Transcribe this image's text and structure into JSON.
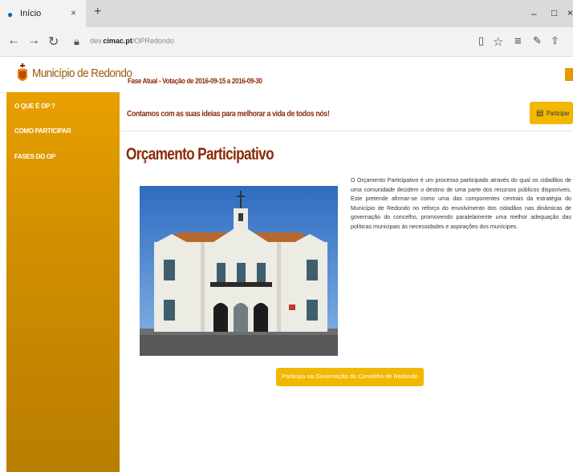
{
  "browser": {
    "tab_title": "Início",
    "tab_close": "×",
    "new_tab": "+",
    "url_prefix": "dev.",
    "url_domain": "cimac.pt",
    "url_path": "/OPRedondo",
    "minimize": "–",
    "maximize": "□",
    "close": "×"
  },
  "header": {
    "logo_text": "Município de Redondo",
    "phase_text": "Fase Atual - Votação de 2016-09-15 a 2016-09-30"
  },
  "sidebar": {
    "items": [
      {
        "label": "O QUE É OP ?"
      },
      {
        "label": "COMO PARTICIPAR"
      },
      {
        "label": "FASES DO OP"
      }
    ]
  },
  "tagline": "Contamos com as suas ideias para melhorar a vida de todos nós!",
  "participar_label": "Participar",
  "page_title": "Orçamento Participativo",
  "description": "O Orçamento Participativo é um processo participado através do qual os cidadãos de uma comunidade decidem o destino de uma parte dos recursos públicos disponíveis. Este pretende afirmar-se como uma das componentes centrais da estratégia do Município de Redondo no reforço do envolvimento dos cidadãos nas dinâmicas de governação do concelho, promovendo paralelamente uma melhor adequação das políticas municipais às necessidades e aspirações dos munícipes.",
  "cta_label": "Participa na Governação do Concelho de Redondo",
  "colors": {
    "accent": "#f2b800",
    "sidebar": "#d18f00",
    "title": "#8b2b08"
  }
}
